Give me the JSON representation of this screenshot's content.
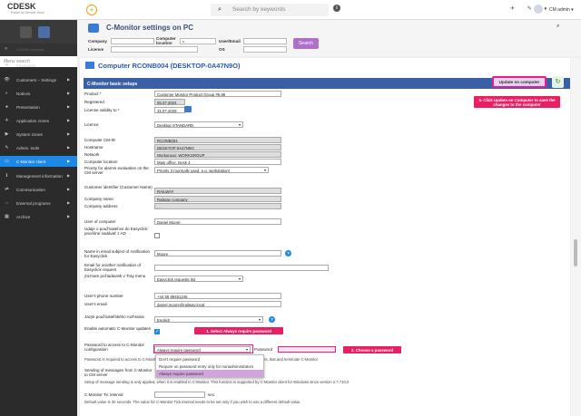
{
  "app": {
    "brand": "CDESK",
    "brand_tag": "Power for Service Desk",
    "search_placeholder": "Search by keywords",
    "user": "CM admin ▾",
    "top_icons": "✈ ✎ ♦"
  },
  "header": {
    "title": "C-Monitor settings on PC",
    "filters": {
      "company": "Company",
      "location": "Computer location",
      "location_value": "x",
      "user_email": "User/Email",
      "license": "Licence",
      "os": "OS"
    },
    "search_button": "Search"
  },
  "sidebar": {
    "collapse": "«",
    "company_placeholder": "CDESK company",
    "search_placeholder": "Menu search",
    "items": [
      {
        "icon": "★",
        "label": "Favourites",
        "arrow": ""
      },
      {
        "icon": "👁",
        "label": "Customers – Settings",
        "arrow": "▶"
      },
      {
        "icon": "◐",
        "label": "Notices",
        "arrow": "▶"
      },
      {
        "icon": "●",
        "label": "Presentation",
        "arrow": "▶"
      },
      {
        "icon": "✈",
        "label": "Application zones",
        "arrow": "▶"
      },
      {
        "icon": "▶",
        "label": "System zones",
        "arrow": "▶"
      },
      {
        "icon": "✎",
        "label": "Admin. tools",
        "arrow": "▶"
      },
      {
        "icon": "▭",
        "label": "C-Monitor client",
        "arrow": "▶"
      },
      {
        "icon": "ℹ",
        "label": "Management information",
        "arrow": "▶"
      },
      {
        "icon": "⇄",
        "label": "Communication",
        "arrow": "▶"
      },
      {
        "icon": "⇔",
        "label": "External programs",
        "arrow": "▶"
      },
      {
        "icon": "▦",
        "label": "Archive",
        "arrow": "▶"
      }
    ]
  },
  "content": {
    "computer_title": "Computer RCONB004 (DESKTOP-0A47N9O)",
    "section": "C-Monitor basic setups",
    "update_button": "Update on computer",
    "fields": {
      "product_l": "Product *",
      "product_v": "Customer Monitor Product Group #5.86",
      "registered_l": "Registered",
      "registered_v": "06.07.2024",
      "validity_l": "License validity to *",
      "validity_v": "31.07.2025",
      "licence_l": "Licence",
      "licence_v": "Desktop STANDARD",
      "cmid_l": "Computer CM-ID",
      "cmid_v": "RCONB004",
      "hostname_l": "Hostname",
      "hostname_v": "DESKTOP-0A47N9O",
      "network_l": "Network",
      "network_v": "Workgroup: WORKGROUP",
      "location_l": "Computer location",
      "location_v": "Main office, Desk 4",
      "priority_l": "Priority for alarms evaluation on the CM server",
      "priority_v": "Priority 3 (normally used, e.g. workstation)",
      "custid_l": "Customer identifier (Customer Name)",
      "custid_v": "RAILWAY",
      "compname_l": "Company name",
      "compname_v": "Railway company",
      "compaddr_l": "Company address",
      "compaddr_v": ", ,",
      "user_l": "User of computer",
      "user_v": "Daniel Moore",
      "easyclick_l": "Udaje o používateľovi do Easyclick priorišne nadávať z AD",
      "notif_l": "Name in email subject of notification for Easyclick",
      "notif_v": "Moore",
      "email_notif_l": "Email for another notification of Easyclick request",
      "tray_l": "Zoznam požiadaviek v Tray menu",
      "tray_v": "Easyclick requests list",
      "phone_l": "User's phone number",
      "phone_v": "+44 55 89451246",
      "email_l": "User's email",
      "email_v": "daniel.moore@railway.local",
      "lang_l": "Jazyk používateľského rozhrania",
      "lang_v": "English",
      "autoupd_l": "Enable automatic C-Monitor updates",
      "pwd_l": "Password to access to C-Monitor configuration",
      "pwd_v": "Always require password",
      "pwd_label2": "Password",
      "pwd_note": "Password is required to access to C-Monitor configuration, it does not have to be applied to all computer files, Ikat and terminate C-Monitor",
      "sending_l": "Sending of messages from C-Monitor to CM server",
      "sending_note": "Setup of message sending is only applied, when it is enabled in C-Monitor. This function is supported by C-Monitor client for Windows since version 2.7.710.0",
      "tick_l": "C-Monitor Tic interval",
      "tick_unit": "sec.",
      "tick_note": "Default value is 30 seconds. The value for C-Monitor Tick interval needs to be set only if you wish to use a different default value."
    },
    "dropdown_options": [
      "Don't require password",
      "Require on password entry only for nonadministrators",
      "Always require password"
    ],
    "callouts": {
      "c1": "1. Select Always require password",
      "c2": "2. Choose a password",
      "c3": "3. Click Update on Computer to save the changes to the computer"
    }
  }
}
